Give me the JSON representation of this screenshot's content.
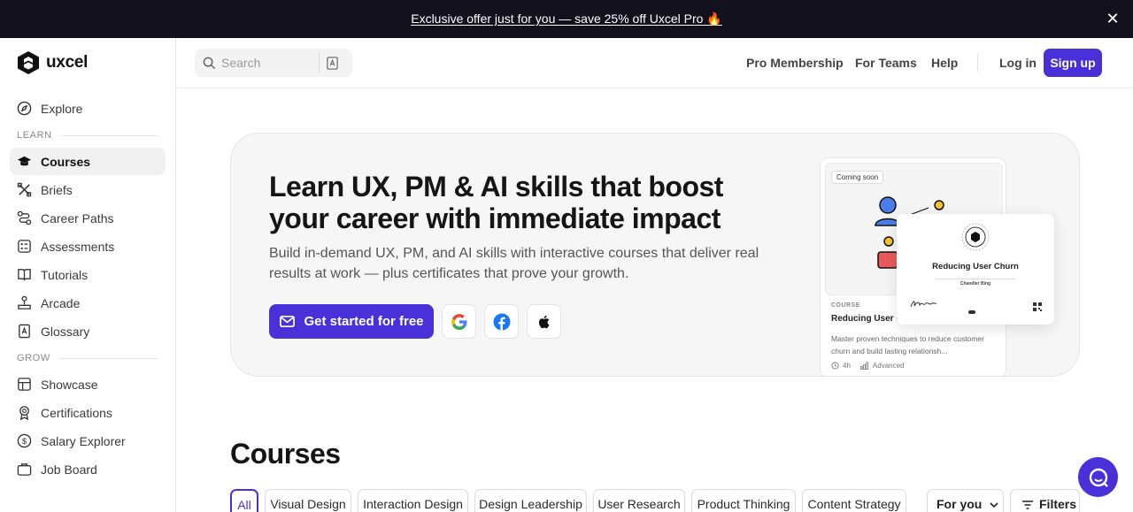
{
  "promo": {
    "text": "Exclusive offer just for you — save 25% off Uxcel Pro 🔥",
    "close_icon": "close-icon"
  },
  "brand": {
    "name": "uxcel",
    "accent": "#4930d9",
    "dark": "#14111f"
  },
  "sidebar": {
    "items_top": [
      {
        "label": "Explore",
        "icon": "compass-icon"
      }
    ],
    "section_learn": "LEARN",
    "learn_items": [
      {
        "label": "Courses",
        "icon": "graduation-cap-icon",
        "active": true
      },
      {
        "label": "Briefs",
        "icon": "tools-icon"
      },
      {
        "label": "Career Paths",
        "icon": "path-icon"
      },
      {
        "label": "Assessments",
        "icon": "assessment-icon"
      },
      {
        "label": "Tutorials",
        "icon": "book-icon"
      },
      {
        "label": "Arcade",
        "icon": "joystick-icon"
      },
      {
        "label": "Glossary",
        "icon": "glossary-icon"
      }
    ],
    "section_grow": "GROW",
    "grow_items": [
      {
        "label": "Showcase",
        "icon": "showcase-icon"
      },
      {
        "label": "Certifications",
        "icon": "badge-icon"
      },
      {
        "label": "Salary Explorer",
        "icon": "dollar-icon"
      },
      {
        "label": "Job Board",
        "icon": "briefcase-icon"
      }
    ]
  },
  "header": {
    "search_placeholder": "Search",
    "nav": [
      "Pro Membership",
      "For Teams",
      "Help"
    ],
    "login": "Log in",
    "signup": "Sign up"
  },
  "hero": {
    "title": "Learn UX, PM & AI skills that boost your career with immediate impact",
    "subtitle": "Build in-demand UX, PM, and AI skills with interactive courses that deliver real results at work — plus certificates that prove your growth.",
    "cta": "Get started for free",
    "social": [
      "google-icon",
      "facebook-icon",
      "apple-icon"
    ],
    "card": {
      "badge": "Coming soon",
      "category": "COURSE",
      "title": "Reducing User Churn",
      "title_visible": "Reducing User C",
      "description": "Master proven techniques to reduce customer churn and build lasting relationsh...",
      "duration": "4h",
      "level": "Advanced"
    },
    "certificate": {
      "title": "Reducing User Churn",
      "name": "Chandler Bing"
    }
  },
  "courses": {
    "title": "Courses",
    "chips": [
      "All",
      "Visual Design",
      "Interaction Design",
      "Design Leadership",
      "User Research",
      "Product Thinking",
      "Content Strategy"
    ],
    "sort": "For you",
    "filters": "Filters"
  }
}
